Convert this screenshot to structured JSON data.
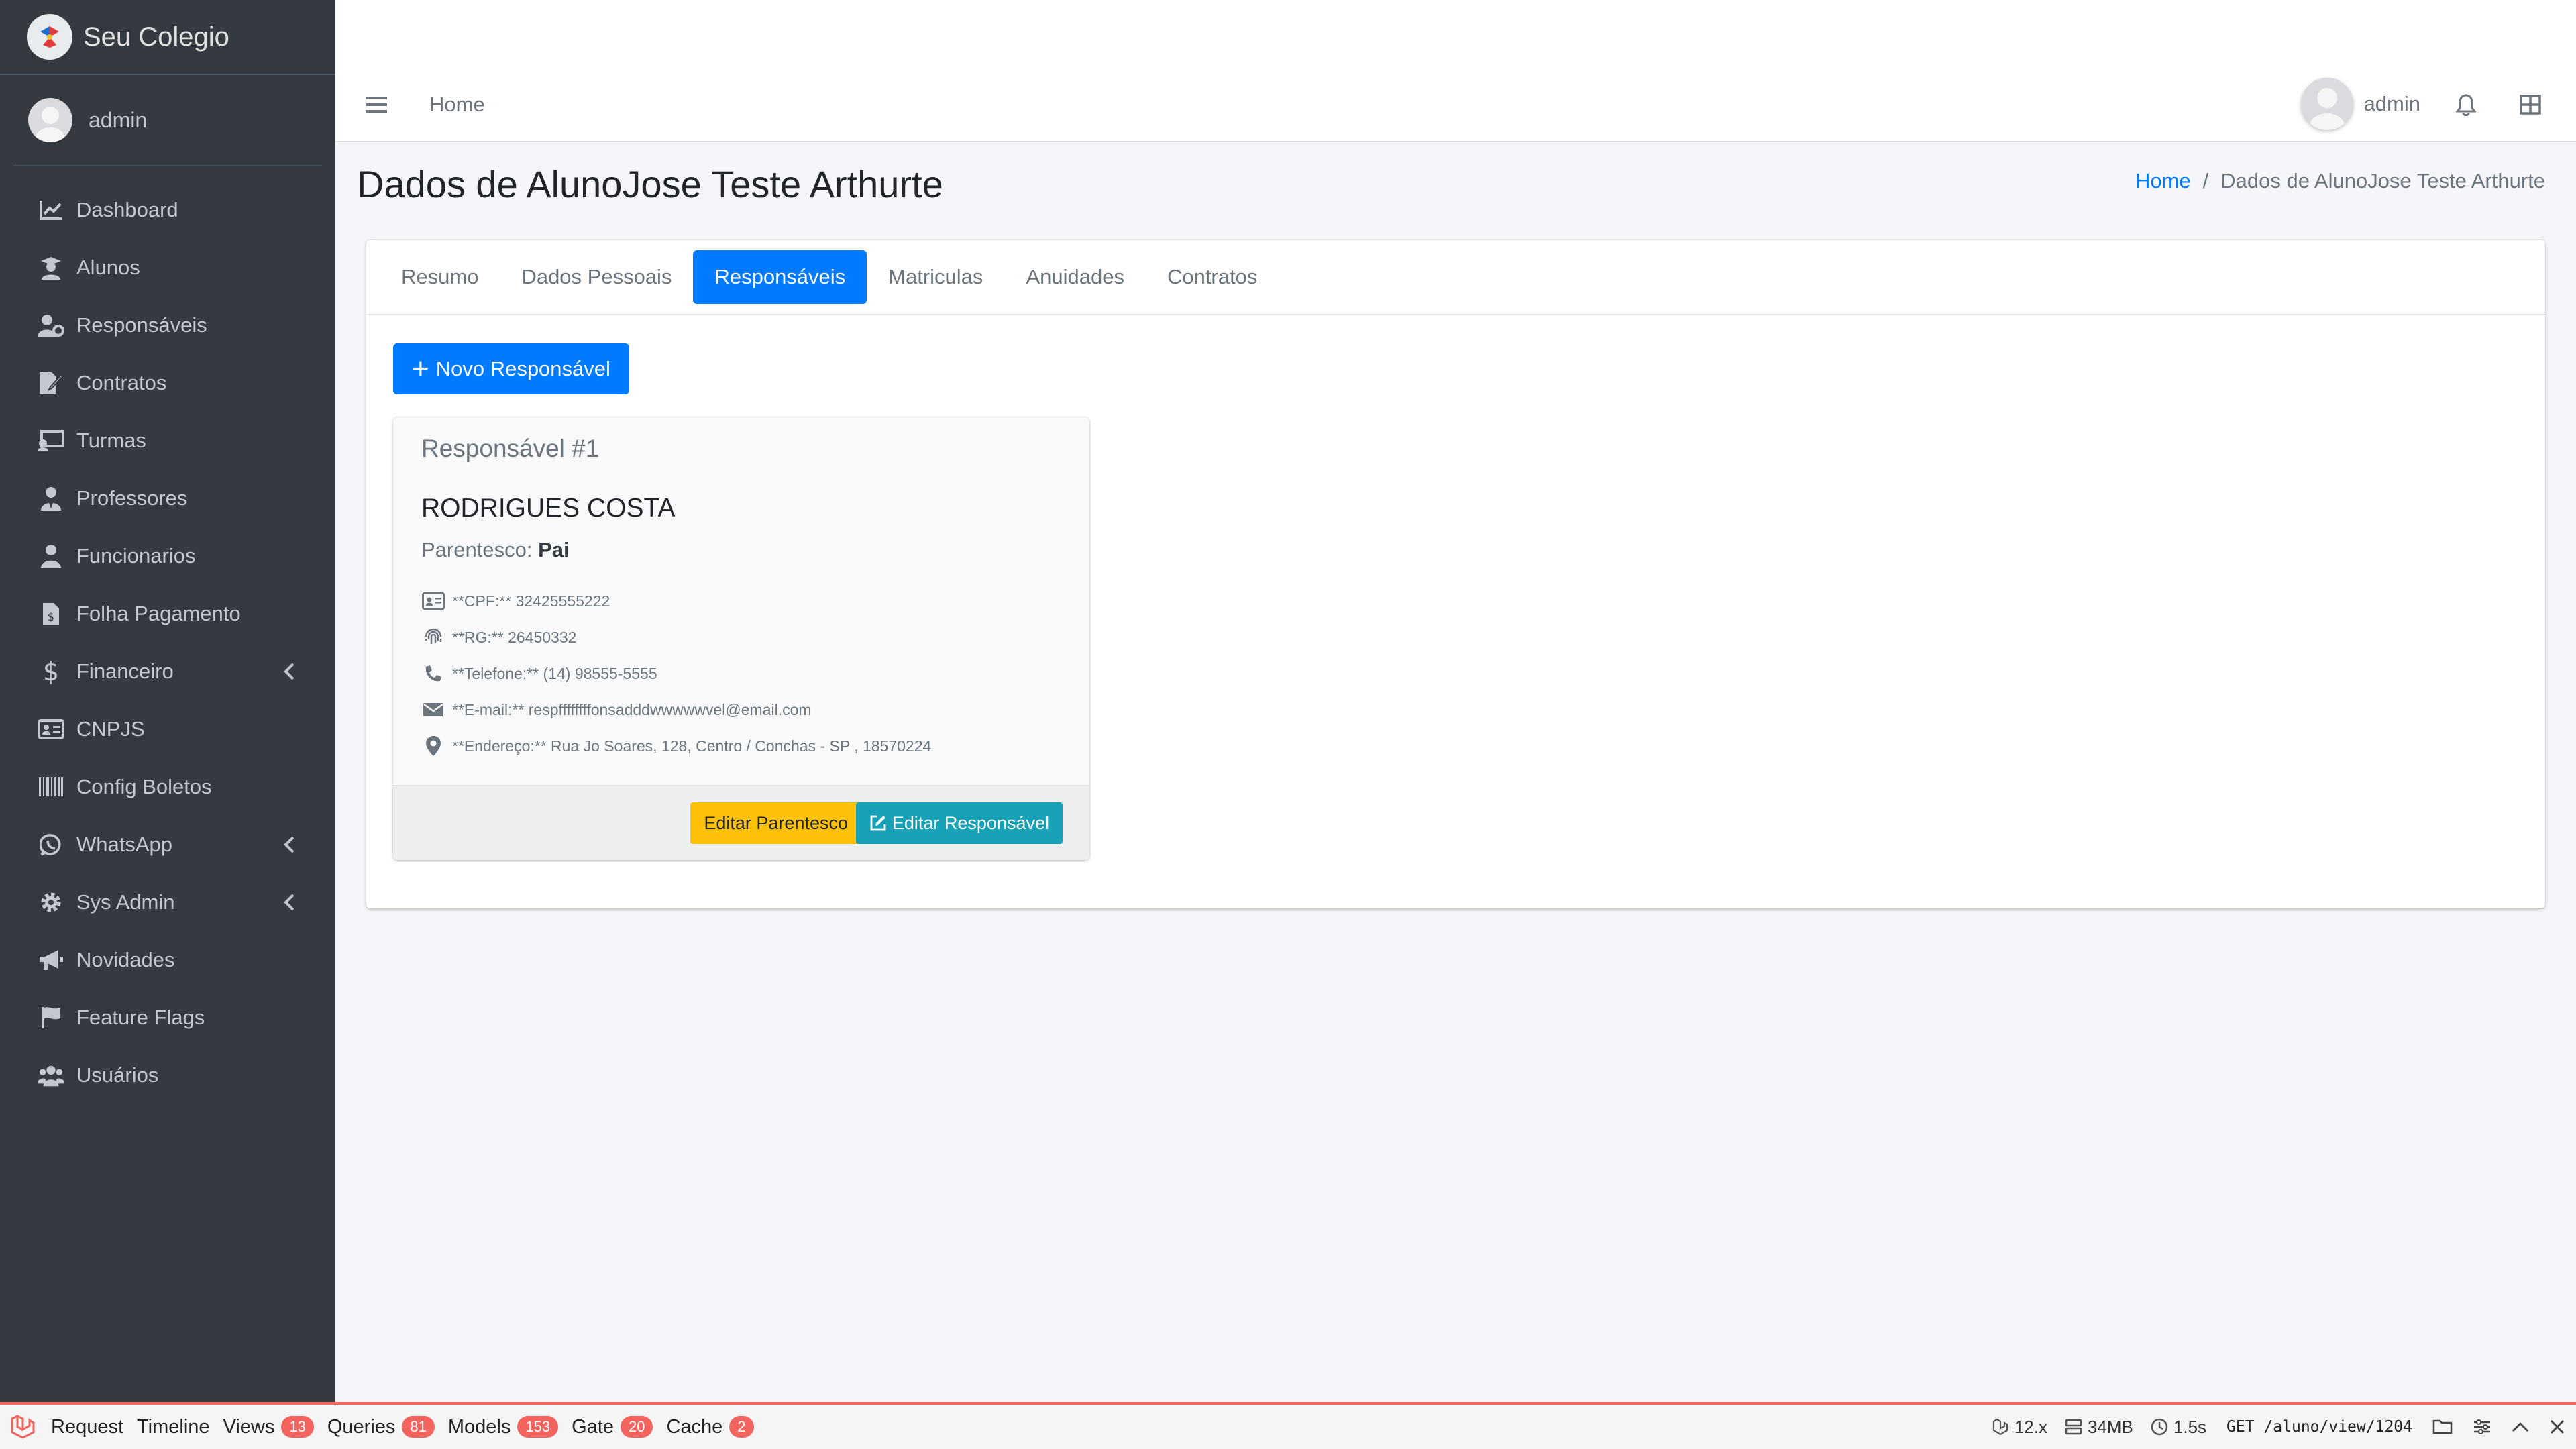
{
  "brand": {
    "name": "Seu Colegio"
  },
  "sidebar": {
    "user": "admin",
    "items": [
      {
        "label": "Dashboard",
        "icon": "chart-line-icon"
      },
      {
        "label": "Alunos",
        "icon": "student-icon"
      },
      {
        "label": "Responsáveis",
        "icon": "user-gear-icon"
      },
      {
        "label": "Contratos",
        "icon": "file-signature-icon"
      },
      {
        "label": "Turmas",
        "icon": "chalkboard-icon"
      },
      {
        "label": "Professores",
        "icon": "user-tie-icon"
      },
      {
        "label": "Funcionarios",
        "icon": "user-icon"
      },
      {
        "label": "Folha Pagamento",
        "icon": "file-invoice-icon"
      },
      {
        "label": "Financeiro",
        "icon": "dollar-icon",
        "has_children": true
      },
      {
        "label": "CNPJS",
        "icon": "id-card-icon"
      },
      {
        "label": "Config Boletos",
        "icon": "barcode-icon"
      },
      {
        "label": "WhatsApp",
        "icon": "whatsapp-icon",
        "has_children": true
      },
      {
        "label": "Sys Admin",
        "icon": "gear-icon",
        "has_children": true
      },
      {
        "label": "Novidades",
        "icon": "bullhorn-icon"
      },
      {
        "label": "Feature Flags",
        "icon": "flag-icon"
      },
      {
        "label": "Usuários",
        "icon": "users-icon"
      }
    ]
  },
  "topbar": {
    "home": "Home",
    "user": "admin"
  },
  "page": {
    "title": "Dados de AlunoJose Teste Arthurte",
    "breadcrumb": {
      "home": "Home",
      "separator": "/",
      "current": "Dados de AlunoJose Teste Arthurte"
    }
  },
  "tabs": [
    {
      "label": "Resumo",
      "active": false
    },
    {
      "label": "Dados Pessoais",
      "active": false
    },
    {
      "label": "Responsáveis",
      "active": true
    },
    {
      "label": "Matriculas",
      "active": false
    },
    {
      "label": "Anuidades",
      "active": false
    },
    {
      "label": "Contratos",
      "active": false
    }
  ],
  "new_button": {
    "plus": "+",
    "label": "Novo Responsável"
  },
  "responsavel": {
    "heading": "Responsável #1",
    "name": "RODRIGUES COSTA",
    "kinship_label": "Parentesco:",
    "kinship_value": "Pai",
    "cpf": "**CPF:** 32425555222",
    "rg": "**RG:** 26450332",
    "telefone": "**Telefone:** (14) 98555-5555",
    "email": "**E-mail:** respffffffffonsadddwwwwwvel@email.com",
    "endereco": "**Endereço:** Rua Jo Soares, 128, Centro / Conchas - SP , 18570224",
    "btn_parentesco": "Editar Parentesco",
    "btn_responsavel": "Editar Responsável"
  },
  "debugbar": {
    "items": [
      {
        "label": "Request"
      },
      {
        "label": "Timeline"
      },
      {
        "label": "Views",
        "badge": "13"
      },
      {
        "label": "Queries",
        "badge": "81"
      },
      {
        "label": "Models",
        "badge": "153"
      },
      {
        "label": "Gate",
        "badge": "20"
      },
      {
        "label": "Cache",
        "badge": "2"
      }
    ],
    "version": "12.x",
    "memory": "34MB",
    "time": "1.5s",
    "route": "GET /aluno/view/1204"
  },
  "colors": {
    "sidebar_bg": "#343a40",
    "primary": "#007bff",
    "warning": "#ffc107",
    "info": "#17a2b8",
    "debug_accent": "#f4645f"
  }
}
